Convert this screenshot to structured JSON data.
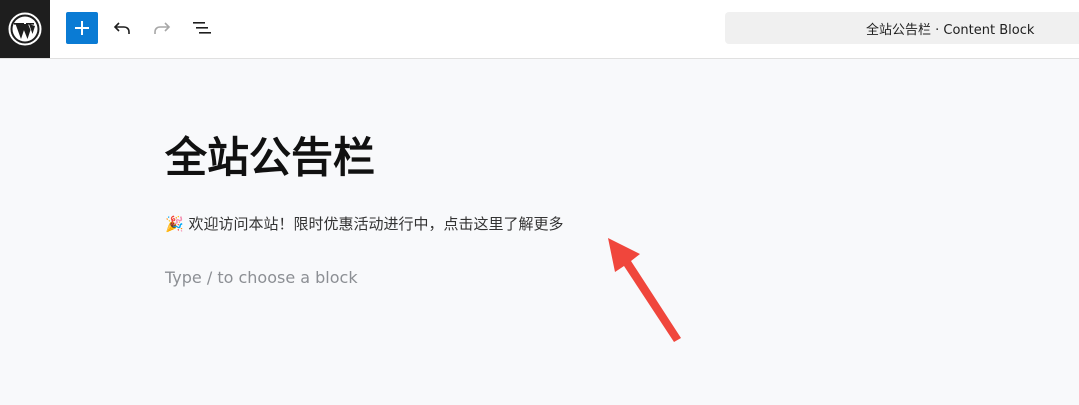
{
  "toolbar": {
    "logo_icon": "wordpress-logo-icon",
    "add_block_icon": "plus-icon",
    "undo_icon": "undo-icon",
    "redo_icon": "redo-icon",
    "document_overview_icon": "list-view-icon",
    "document_title": "全站公告栏 · Content Block",
    "accent_color": "#0a7bd4"
  },
  "editor": {
    "post_title": "全站公告栏",
    "paragraph_emoji": "🎉",
    "paragraph_text": "欢迎访问本站！限时优惠活动进行中，点击这里了解更多",
    "block_placeholder": "Type / to choose a block"
  },
  "annotation": {
    "arrow_icon": "red-arrow-icon",
    "arrow_color": "#f0463c"
  }
}
